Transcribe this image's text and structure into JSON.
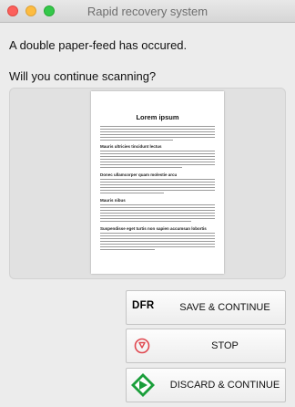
{
  "window": {
    "title": "Rapid recovery system"
  },
  "messages": {
    "line1": "A double paper-feed has occured.",
    "line2": "Will you continue scanning?"
  },
  "preview": {
    "doc_title": "Lorem ipsum",
    "headings": [
      "Mauris ultricies tincidunt lectus",
      "Donec ullamcorper quam molestie arcu",
      "Mauris nibus",
      "Suspendisse eget turtis non sapien accumsan lobortis"
    ]
  },
  "buttons": {
    "save": {
      "icon_text": "DFR",
      "label": "SAVE & CONTINUE"
    },
    "stop": {
      "label": "STOP"
    },
    "discard": {
      "label": "DISCARD & CONTINUE"
    }
  },
  "colors": {
    "close": "#fc605c",
    "minimize": "#fdbc40",
    "maximize": "#34c84a",
    "stop_icon": "#e0474f",
    "discard_icon": "#1a9e3a"
  }
}
